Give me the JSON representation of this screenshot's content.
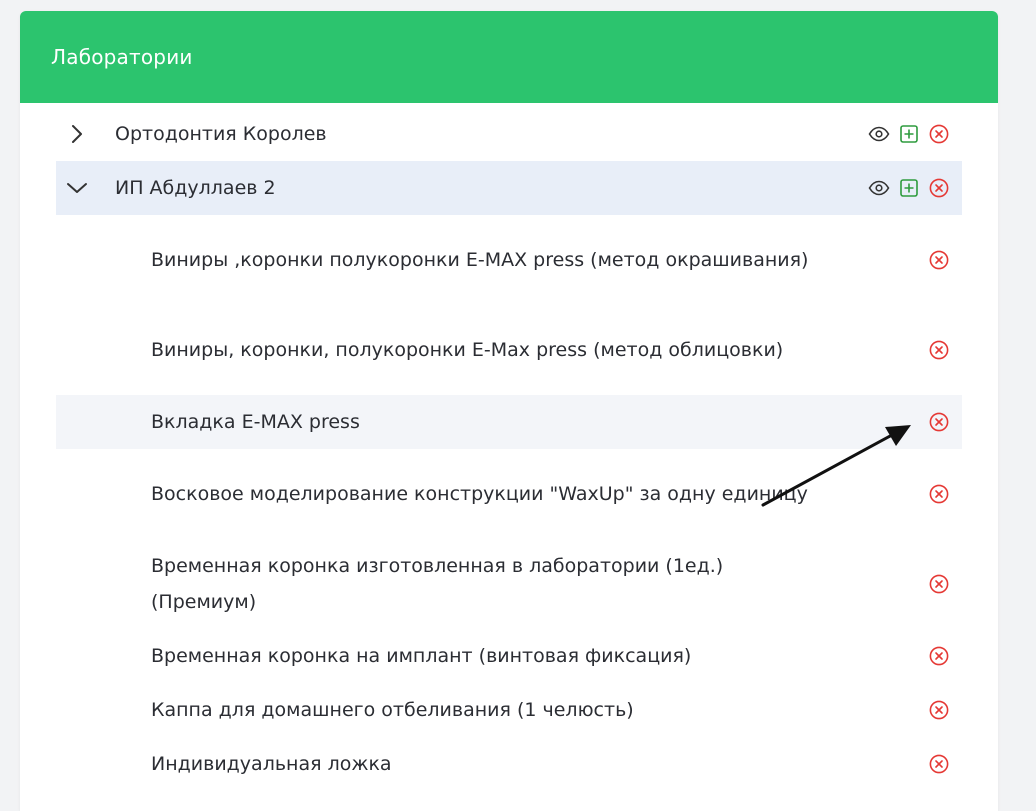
{
  "panel": {
    "title": "Лаборатории"
  },
  "colors": {
    "header_bg": "#2cc46e",
    "delete_icon": "#e53935",
    "add_icon": "#2e9b3e",
    "selected_row": "#e8eef8"
  },
  "labs": [
    {
      "name": "Ортодонтия Королев",
      "expanded": false,
      "icons": [
        "eye-icon",
        "plus-square-icon",
        "close-circle-icon"
      ]
    },
    {
      "name": "ИП Абдуллаев 2",
      "expanded": true,
      "icons": [
        "eye-icon",
        "plus-square-icon",
        "close-circle-icon"
      ]
    }
  ],
  "services": [
    "Виниры ,коронки полукоронки E-MAX press (метод окрашивания)",
    "Виниры, коронки, полукоронки E-Max press (метод облицовки)",
    "Вкладка E-MAX press",
    "Восковое моделирование конструкции \"WaxUp\" за одну единицу",
    "Временная коронка изготовленная в лаборатории (1ед.) (Премиум)",
    "Временная коронка на имплант (винтовая фиксация)",
    "Каппа для домашнего отбеливания (1 челюсть)",
    "Индивидуальная ложка"
  ]
}
